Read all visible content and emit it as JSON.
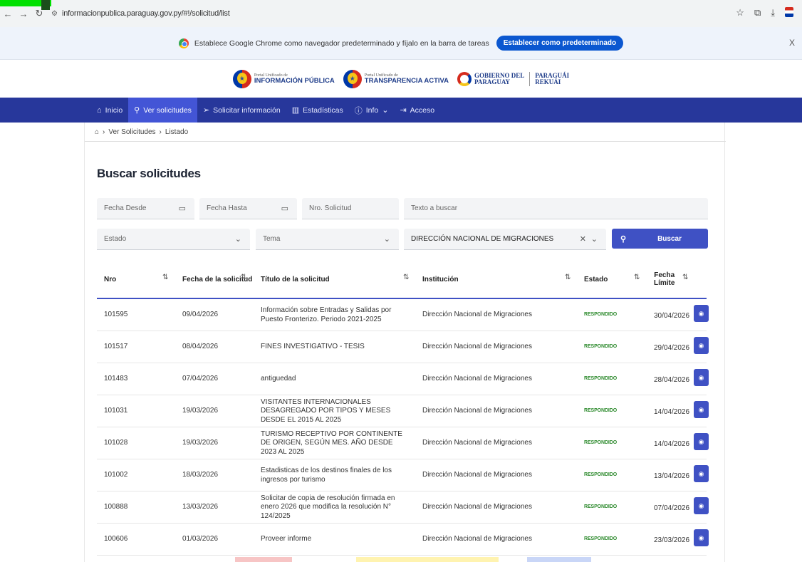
{
  "browser": {
    "url": "informacionpublica.paraguay.gov.py/#!/solicitud/list",
    "infobar_text": "Establece Google Chrome como navegador predeterminado y fíjalo en la barra de tareas",
    "infobar_button": "Establecer como predeterminado",
    "infobar_close": "X"
  },
  "header": {
    "logo1_small": "Portal Unificado de",
    "logo1_big": "INFORMACIÓN PÚBLICA",
    "logo2_small": "Portal Unificado de",
    "logo2_big": "TRANSPARENCIA ACTIVA",
    "logo3_line1": "GOBIERNO DEL",
    "logo3_line2": "PARAGUAY",
    "logo3_line3": "PARAGUÁI",
    "logo3_line4": "REKUÁI"
  },
  "nav": {
    "items": [
      {
        "label": "Inicio",
        "icon": "home-icon"
      },
      {
        "label": "Ver solicitudes",
        "icon": "search-icon"
      },
      {
        "label": "Solicitar información",
        "icon": "send-icon"
      },
      {
        "label": "Estadísticas",
        "icon": "chart-icon"
      },
      {
        "label": "Info",
        "icon": "help-icon"
      },
      {
        "label": "Acceso",
        "icon": "login-icon"
      }
    ]
  },
  "breadcrumb": [
    "Ver Solicitudes",
    "Listado"
  ],
  "page_title": "Buscar solicitudes",
  "filters": {
    "fecha_desde": "Fecha Desde",
    "fecha_hasta": "Fecha Hasta",
    "nro_solicitud": "Nro. Solicitud",
    "texto": "Texto a buscar",
    "estado": "Estado",
    "tema": "Tema",
    "institucion": "DIRECCIÓN NACIONAL DE MIGRACIONES",
    "buscar": "Buscar"
  },
  "table": {
    "headers": {
      "nro": "Nro",
      "fecha": "Fecha de la solicitud",
      "titulo": "Título de la solicitud",
      "institucion": "Institución",
      "estado": "Estado",
      "limite_1": "Fecha",
      "limite_2": "Límite"
    },
    "rows": [
      {
        "nro": "101595",
        "fecha": "09/04/2026",
        "titulo": "Información sobre Entradas y Salidas por Puesto Fronterizo. Periodo 2021-2025",
        "institucion": "Dirección Nacional de Migraciones",
        "estado": "RESPONDIDO",
        "limite": "30/04/2026"
      },
      {
        "nro": "101517",
        "fecha": "08/04/2026",
        "titulo": "FINES INVESTIGATIVO - TESIS",
        "institucion": "Dirección Nacional de Migraciones",
        "estado": "RESPONDIDO",
        "limite": "29/04/2026"
      },
      {
        "nro": "101483",
        "fecha": "07/04/2026",
        "titulo": "antiguedad",
        "institucion": "Dirección Nacional de Migraciones",
        "estado": "RESPONDIDO",
        "limite": "28/04/2026"
      },
      {
        "nro": "101031",
        "fecha": "19/03/2026",
        "titulo": "VISITANTES INTERNACIONALES DESAGREGADO POR TIPOS Y MESES DESDE EL 2015 AL 2025",
        "institucion": "Dirección Nacional de Migraciones",
        "estado": "RESPONDIDO",
        "limite": "14/04/2026"
      },
      {
        "nro": "101028",
        "fecha": "19/03/2026",
        "titulo": "TURISMO RECEPTIVO POR CONTINENTE DE ORIGEN, SEGÚN MES. AÑO DESDE 2023 AL 2025",
        "institucion": "Dirección Nacional de Migraciones",
        "estado": "RESPONDIDO",
        "limite": "14/04/2026"
      },
      {
        "nro": "101002",
        "fecha": "18/03/2026",
        "titulo": "Estadisticas de los destinos finales de los ingresos por turismo",
        "institucion": "Dirección Nacional de Migraciones",
        "estado": "RESPONDIDO",
        "limite": "13/04/2026"
      },
      {
        "nro": "100888",
        "fecha": "13/03/2026",
        "titulo": "Solicitar de copia de resolución firmada en enero 2026 que modifica la resolución N° 124/2025",
        "institucion": "Dirección Nacional de Migraciones",
        "estado": "RESPONDIDO",
        "limite": "07/04/2026"
      },
      {
        "nro": "100606",
        "fecha": "01/03/2026",
        "titulo": "Proveer informe",
        "institucion": "Dirección Nacional de Migraciones",
        "estado": "RESPONDIDO",
        "limite": "23/03/2026"
      }
    ]
  },
  "colors": {
    "nav_bg": "#27379b",
    "accent": "#3f51c4",
    "status_green": "#2e8b2e"
  }
}
